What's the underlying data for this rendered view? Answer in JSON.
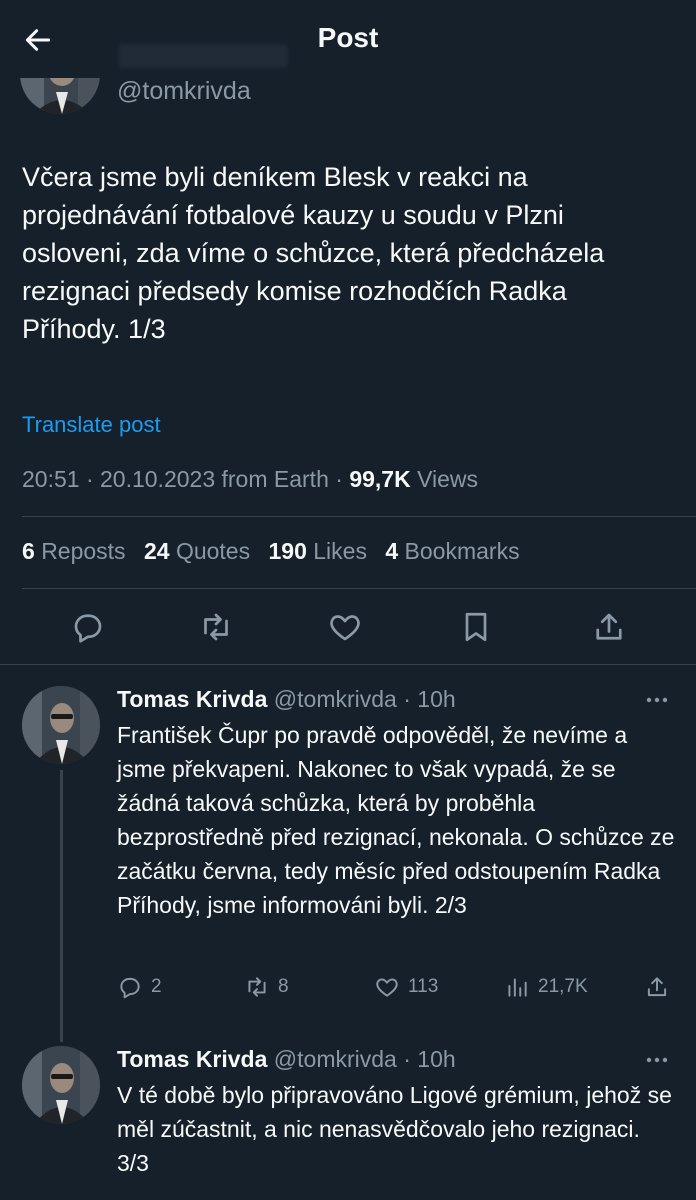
{
  "header": {
    "title": "Post"
  },
  "author": {
    "handle": "@tomkrivda"
  },
  "post": {
    "text": "Včera jsme byli deníkem Blesk v reakci na projednávání fotbalové kauzy u soudu v Plzni osloveni, zda víme o schůzce, která předcházela rezignaci předsedy komise rozhodčích Radka Příhody. 1/3",
    "translate_label": "Translate post",
    "timestamp": "20:51 · 20.10.2023 from Earth ·",
    "views_count": "99,7K",
    "views_label": "Views"
  },
  "stats": {
    "reposts_count": "6",
    "reposts_label": "Reposts",
    "quotes_count": "24",
    "quotes_label": "Quotes",
    "likes_count": "190",
    "likes_label": "Likes",
    "bookmarks_count": "4",
    "bookmarks_label": "Bookmarks"
  },
  "replies": [
    {
      "name": "Tomas Krivda",
      "handle_time": "@tomkrivda · 10h",
      "text": "František Čupr po pravdě odpověděl, že nevíme a jsme překvapeni. Nakonec to však vypadá, že se žádná taková schůzka, která by proběhla bezprostředně před rezignací, nekonala. O schůzce ze začátku června, tedy měsíc před odstoupením Radka Příhody, jsme informováni byli. 2/3",
      "replies": "2",
      "reposts": "8",
      "likes": "113",
      "views": "21,7K"
    },
    {
      "name": "Tomas Krivda",
      "handle_time": "@tomkrivda · 10h",
      "text": "V té době bylo připravováno Ligové grémium, jehož se měl zúčastnit, a nic nenasvědčovalo jeho rezignaci. 3/3"
    }
  ],
  "colors": {
    "background": "#15202b",
    "text": "#f7f9f9",
    "secondary": "#8b98a5",
    "link": "#1d9bf0",
    "divider": "#38444d"
  },
  "icons": [
    "back-arrow-icon",
    "reply-icon",
    "repost-icon",
    "like-icon",
    "bookmark-icon",
    "share-icon",
    "more-icon",
    "views-icon"
  ]
}
